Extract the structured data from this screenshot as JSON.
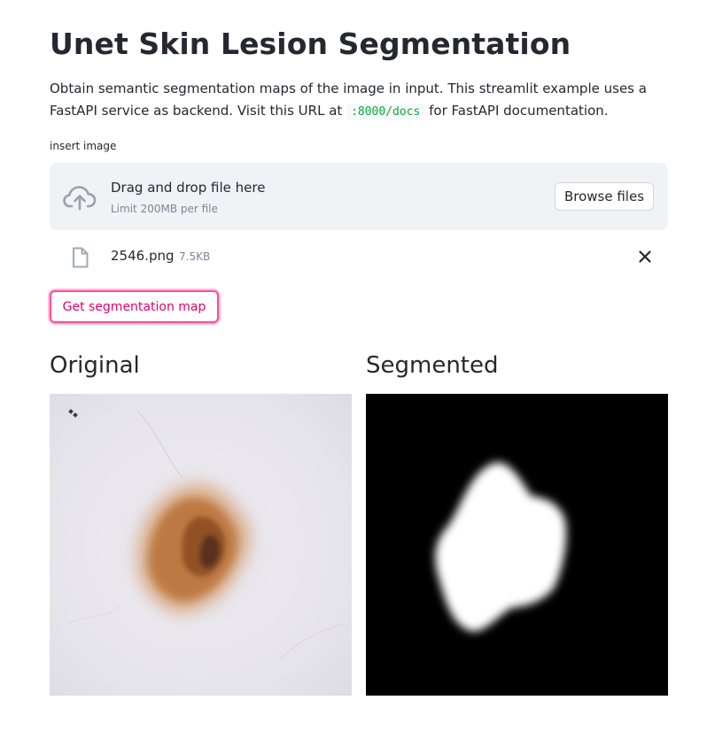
{
  "header": {
    "title": "Unet Skin Lesion Segmentation"
  },
  "description": {
    "text_before": "Obtain semantic segmentation maps of the image in input. This streamlit example uses a FastAPI service as backend. Visit this URL at ",
    "code": ":8000/docs",
    "text_after": " for FastAPI documentation."
  },
  "uploader": {
    "label": "insert image",
    "drop_title": "Drag and drop file here",
    "limit_text": "Limit 200MB per file",
    "browse_label": "Browse files",
    "file": {
      "name": "2546.png",
      "size": "7.5KB"
    },
    "icons": {
      "upload": "cloud-upload-icon",
      "file": "file-icon",
      "remove": "close-icon"
    }
  },
  "actions": {
    "submit_label": "Get segmentation map",
    "accent_color": "#ff4b9a"
  },
  "columns": {
    "original": {
      "heading": "Original"
    },
    "segmented": {
      "heading": "Segmented"
    }
  },
  "colors": {
    "text": "#262730",
    "muted": "#808495",
    "dropzone_bg": "#f0f2f6",
    "code": "#09ab3b"
  }
}
